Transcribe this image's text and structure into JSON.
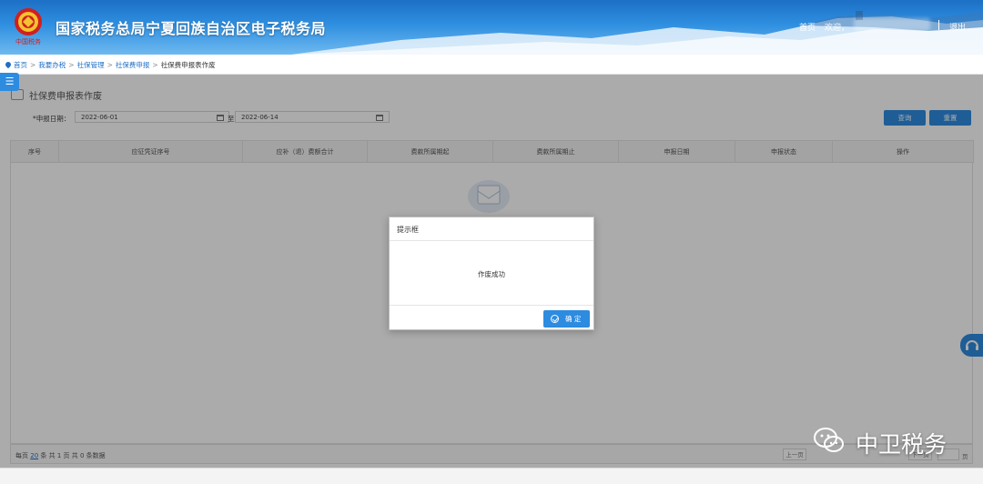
{
  "header": {
    "emblem_caption": "中国税务",
    "site_title": "国家税务总局宁夏回族自治区电子税务局",
    "home_link": "首页",
    "welcome": "欢迎，",
    "logout": "退出"
  },
  "breadcrumb": [
    "首页",
    "我要办税",
    "社保管理",
    "社保费申报",
    "社保费申报表作废"
  ],
  "breadcrumb_separator": ">",
  "page": {
    "title": "社保费申报表作废",
    "date_label": "*申报日期：",
    "date_from": "2022-06-01",
    "date_separator": "至 -",
    "date_to": "2022-06-14",
    "query_button": "查询",
    "reset_button": "重置"
  },
  "table": {
    "columns": [
      "序号",
      "应征凭证序号",
      "应补（退）费额合计",
      "费款所属期起",
      "费款所属期止",
      "申报日期",
      "申报状态",
      "操作"
    ]
  },
  "pager": {
    "prefix": "每页",
    "page_size": "20",
    "middle": "条 共 1 页",
    "total": "共 0 条数据",
    "prev_label": "上一页",
    "next_label": "下一页",
    "goto_suffix": "页"
  },
  "dialog": {
    "title": "提示框",
    "message": "作废成功",
    "ok_button": "确 定"
  },
  "watermark": {
    "text": "中卫税务"
  },
  "colors": {
    "primary": "#2d8be0",
    "header_dark": "#1c6fc4",
    "link": "#1f6fc5"
  }
}
